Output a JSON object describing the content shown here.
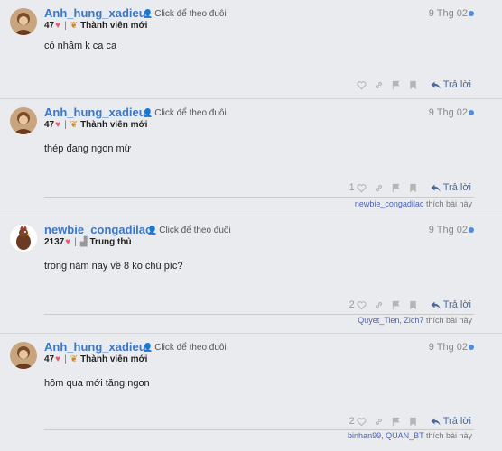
{
  "colors": {
    "username": "#3b78c9",
    "heart": "#e45c71",
    "unread_dot": "#4c8ee0",
    "link": "#4c63b8",
    "background": "#e9ebee"
  },
  "posts": [
    {
      "username": "Anh_hung_xadieu",
      "follow_label": "Click để theo đuôi",
      "score": "47",
      "badge": "Thành viên mới",
      "badge_icon": "sprout-icon",
      "date": "9 Thg 02",
      "content": "có nhầm k ca ca",
      "like_count": "",
      "reply_label": "Trả lời",
      "likers_names": "",
      "likers_suffix": ""
    },
    {
      "username": "Anh_hung_xadieu",
      "follow_label": "Click để theo đuôi",
      "score": "47",
      "badge": "Thành viên mới",
      "badge_icon": "sprout-icon",
      "date": "9 Thg 02",
      "content": "thép đang ngon mừ",
      "like_count": "1",
      "reply_label": "Trả lời",
      "likers_names": "newbie_congadilac",
      "likers_suffix": "thích bài này"
    },
    {
      "username": "newbie_congadilac",
      "follow_label": "Click để theo đuôi",
      "score": "2137",
      "badge": "Trung thủ",
      "badge_icon": "medal-icon",
      "date": "9 Thg 02",
      "content": "trong năm nay về 8 ko chú píc?",
      "like_count": "2",
      "reply_label": "Trả lời",
      "likers_names": "Quyet_Tien, Zich7",
      "likers_suffix": "thích bài này"
    },
    {
      "username": "Anh_hung_xadieu",
      "follow_label": "Click để theo đuôi",
      "score": "47",
      "badge": "Thành viên mới",
      "badge_icon": "sprout-icon",
      "date": "9 Thg 02",
      "content": "hôm qua mới tăng ngon",
      "like_count": "2",
      "reply_label": "Trả lời",
      "likers_names": "binhan99, QUAN_BT",
      "likers_suffix": "thích bài này"
    }
  ]
}
